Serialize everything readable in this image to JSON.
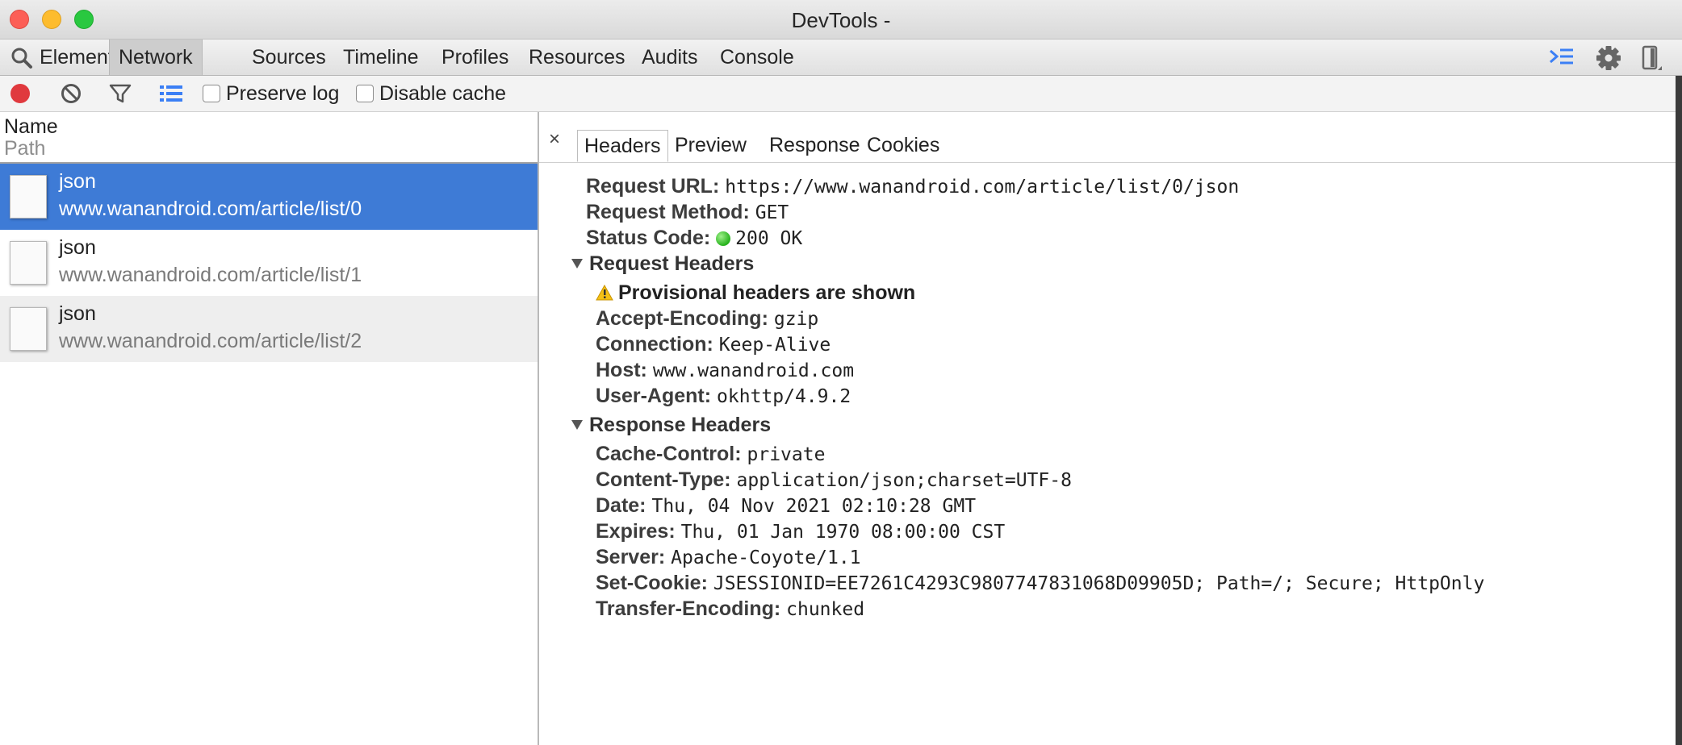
{
  "window": {
    "title": "DevTools -"
  },
  "main_tabs": [
    "Elements",
    "Network",
    "Sources",
    "Timeline",
    "Profiles",
    "Resources",
    "Audits",
    "Console"
  ],
  "active_main_tab": "Network",
  "toolbar": {
    "preserve_log": "Preserve log",
    "disable_cache": "Disable cache"
  },
  "list": {
    "col_name": "Name",
    "col_path": "Path",
    "requests": [
      {
        "name": "json",
        "path": "www.wanandroid.com/article/list/0"
      },
      {
        "name": "json",
        "path": "www.wanandroid.com/article/list/1"
      },
      {
        "name": "json",
        "path": "www.wanandroid.com/article/list/2"
      }
    ]
  },
  "detail": {
    "close": "×",
    "tabs": [
      "Headers",
      "Preview",
      "Response",
      "Cookies"
    ],
    "active_tab": "Headers",
    "general": [
      {
        "key": "Request URL:",
        "value": "https://www.wanandroid.com/article/list/0/json"
      },
      {
        "key": "Request Method:",
        "value": "GET"
      },
      {
        "key": "Status Code:",
        "value": "200 OK"
      }
    ],
    "request_headers_title": "Request Headers",
    "provisional_warning": "Provisional headers are shown",
    "request_headers": [
      {
        "key": "Accept-Encoding:",
        "value": "gzip"
      },
      {
        "key": "Connection:",
        "value": "Keep-Alive"
      },
      {
        "key": "Host:",
        "value": "www.wanandroid.com"
      },
      {
        "key": "User-Agent:",
        "value": "okhttp/4.9.2"
      }
    ],
    "response_headers_title": "Response Headers",
    "response_headers": [
      {
        "key": "Cache-Control:",
        "value": "private"
      },
      {
        "key": "Content-Type:",
        "value": "application/json;charset=UTF-8"
      },
      {
        "key": "Date:",
        "value": "Thu, 04 Nov 2021 02:10:28 GMT"
      },
      {
        "key": "Expires:",
        "value": "Thu, 01 Jan 1970 08:00:00 CST"
      },
      {
        "key": "Server:",
        "value": "Apache-Coyote/1.1"
      },
      {
        "key": "Set-Cookie:",
        "value": "JSESSIONID=EE7261C4293C9807747831068D09905D; Path=/; Secure; HttpOnly"
      },
      {
        "key": "Transfer-Encoding:",
        "value": "chunked"
      }
    ]
  },
  "colors": {
    "selection": "#3e7bd6",
    "record": "#e0393e",
    "status_ok": "#26b21c",
    "accent_icon": "#3b7ff5"
  },
  "icons": [
    "search-icon",
    "drawer-toggle-icon",
    "gear-icon",
    "dock-side-icon",
    "record-icon",
    "clear-icon",
    "filter-icon",
    "large-rows-icon",
    "file-icon",
    "warning-icon",
    "triangle-down-icon",
    "status-dot-icon"
  ]
}
